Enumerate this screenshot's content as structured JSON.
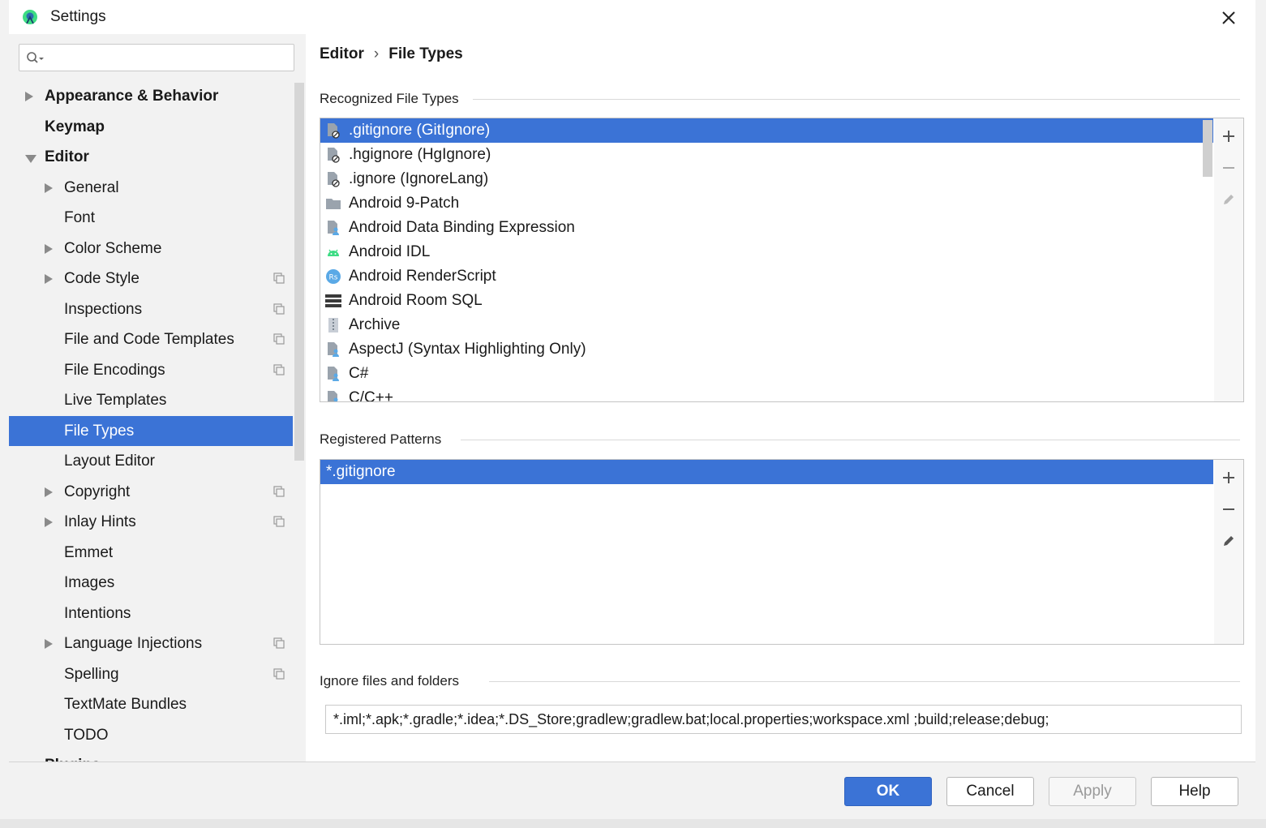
{
  "window": {
    "title": "Settings"
  },
  "search": {
    "placeholder": "",
    "value": ""
  },
  "tree": [
    {
      "label": "Appearance & Behavior",
      "level": 0,
      "arrow": "right",
      "bold": true,
      "project": false,
      "selected": false
    },
    {
      "label": "Keymap",
      "level": 0,
      "arrow": "none",
      "bold": true,
      "project": false,
      "selected": false
    },
    {
      "label": "Editor",
      "level": 0,
      "arrow": "down",
      "bold": true,
      "project": false,
      "selected": false
    },
    {
      "label": "General",
      "level": 1,
      "arrow": "right",
      "bold": false,
      "project": false,
      "selected": false
    },
    {
      "label": "Font",
      "level": 1,
      "arrow": "none",
      "bold": false,
      "project": false,
      "selected": false
    },
    {
      "label": "Color Scheme",
      "level": 1,
      "arrow": "right",
      "bold": false,
      "project": false,
      "selected": false
    },
    {
      "label": "Code Style",
      "level": 1,
      "arrow": "right",
      "bold": false,
      "project": true,
      "selected": false
    },
    {
      "label": "Inspections",
      "level": 1,
      "arrow": "none",
      "bold": false,
      "project": true,
      "selected": false
    },
    {
      "label": "File and Code Templates",
      "level": 1,
      "arrow": "none",
      "bold": false,
      "project": true,
      "selected": false
    },
    {
      "label": "File Encodings",
      "level": 1,
      "arrow": "none",
      "bold": false,
      "project": true,
      "selected": false
    },
    {
      "label": "Live Templates",
      "level": 1,
      "arrow": "none",
      "bold": false,
      "project": false,
      "selected": false
    },
    {
      "label": "File Types",
      "level": 1,
      "arrow": "none",
      "bold": false,
      "project": false,
      "selected": true
    },
    {
      "label": "Layout Editor",
      "level": 1,
      "arrow": "none",
      "bold": false,
      "project": false,
      "selected": false
    },
    {
      "label": "Copyright",
      "level": 1,
      "arrow": "right",
      "bold": false,
      "project": true,
      "selected": false
    },
    {
      "label": "Inlay Hints",
      "level": 1,
      "arrow": "right",
      "bold": false,
      "project": true,
      "selected": false
    },
    {
      "label": "Emmet",
      "level": 1,
      "arrow": "none",
      "bold": false,
      "project": false,
      "selected": false
    },
    {
      "label": "Images",
      "level": 1,
      "arrow": "none",
      "bold": false,
      "project": false,
      "selected": false
    },
    {
      "label": "Intentions",
      "level": 1,
      "arrow": "none",
      "bold": false,
      "project": false,
      "selected": false
    },
    {
      "label": "Language Injections",
      "level": 1,
      "arrow": "right",
      "bold": false,
      "project": true,
      "selected": false
    },
    {
      "label": "Spelling",
      "level": 1,
      "arrow": "none",
      "bold": false,
      "project": true,
      "selected": false
    },
    {
      "label": "TextMate Bundles",
      "level": 1,
      "arrow": "none",
      "bold": false,
      "project": false,
      "selected": false
    },
    {
      "label": "TODO",
      "level": 1,
      "arrow": "none",
      "bold": false,
      "project": false,
      "selected": false
    },
    {
      "label": "Plugins",
      "level": 0,
      "arrow": "none",
      "bold": true,
      "project": false,
      "selected": false
    }
  ],
  "breadcrumb": {
    "parent": "Editor",
    "separator": "›",
    "current": "File Types"
  },
  "recognized": {
    "label": "Recognized File Types",
    "items": [
      {
        "label": ".gitignore (GitIgnore)",
        "icon": "ignore-file-icon",
        "selected": true
      },
      {
        "label": ".hgignore (HgIgnore)",
        "icon": "ignore-file-icon",
        "selected": false
      },
      {
        "label": ".ignore (IgnoreLang)",
        "icon": "ignore-file-icon",
        "selected": false
      },
      {
        "label": "Android 9-Patch",
        "icon": "folder-icon",
        "selected": false
      },
      {
        "label": "Android Data Binding Expression",
        "icon": "generic-file-icon",
        "selected": false
      },
      {
        "label": "Android IDL",
        "icon": "android-icon",
        "selected": false
      },
      {
        "label": "Android RenderScript",
        "icon": "renderscript-icon",
        "selected": false
      },
      {
        "label": "Android Room SQL",
        "icon": "database-icon",
        "selected": false
      },
      {
        "label": "Archive",
        "icon": "archive-icon",
        "selected": false
      },
      {
        "label": "AspectJ (Syntax Highlighting Only)",
        "icon": "generic-file-icon",
        "selected": false
      },
      {
        "label": "C#",
        "icon": "generic-file-icon",
        "selected": false
      },
      {
        "label": "C/C++",
        "icon": "generic-file-icon",
        "selected": false
      }
    ]
  },
  "patterns": {
    "label": "Registered Patterns",
    "items": [
      {
        "label": "*.gitignore",
        "selected": true
      }
    ]
  },
  "ignore": {
    "label": "Ignore files and folders",
    "value": "*.iml;*.apk;*.gradle;*.idea;*.DS_Store;gradlew;gradlew.bat;local.properties;workspace.xml ;build;release;debug;"
  },
  "buttons": {
    "ok": "OK",
    "cancel": "Cancel",
    "apply": "Apply",
    "help": "Help"
  },
  "colors": {
    "selection": "#3b73d6",
    "panel": "#f2f2f2",
    "android_green": "#3ddc84",
    "rs_blue": "#5aa9e6"
  }
}
